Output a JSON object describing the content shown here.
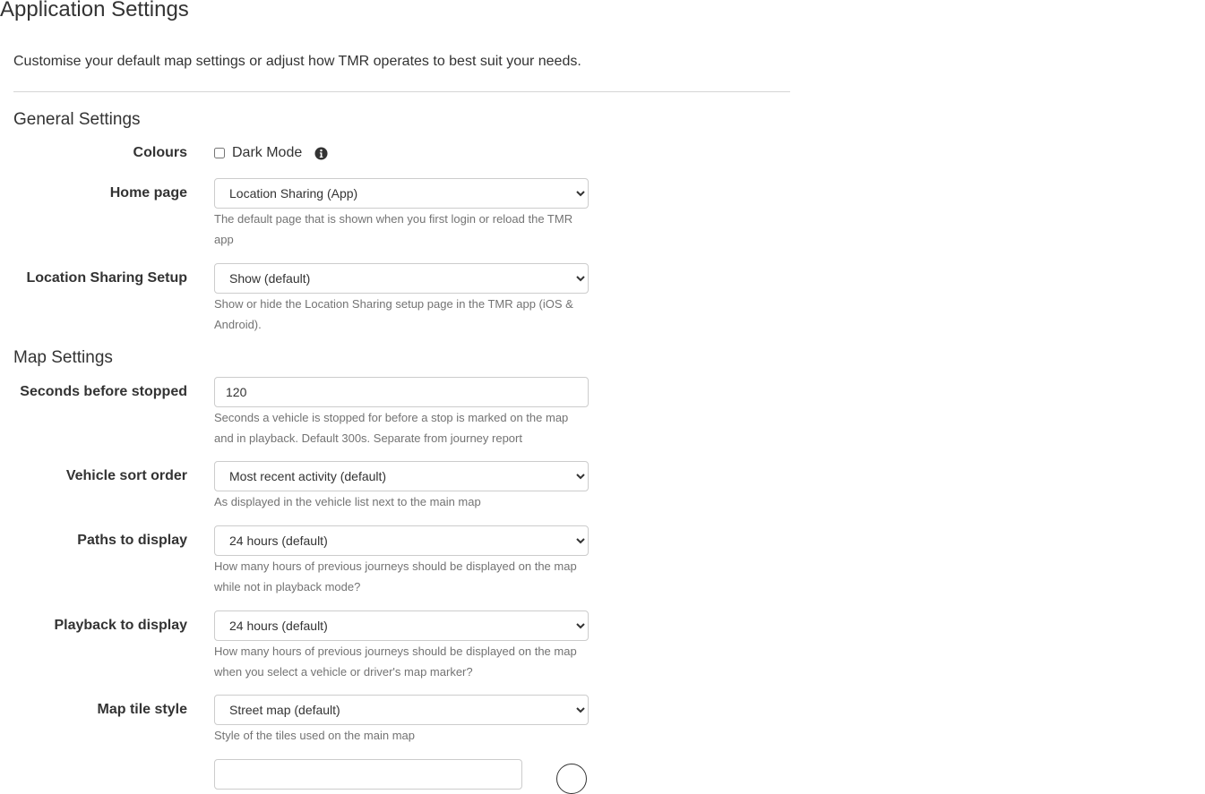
{
  "page": {
    "title": "Application Settings",
    "intro": "Customise your default map settings or adjust how TMR operates to best suit your needs."
  },
  "general": {
    "title": "General Settings",
    "colours": {
      "label": "Colours",
      "checkbox_label": "Dark Mode",
      "checked": false,
      "info_icon": "info-circle-icon"
    },
    "home_page": {
      "label": "Home page",
      "value": "Location Sharing (App)",
      "help": "The default page that is shown when you first login or reload the TMR app"
    },
    "location_sharing": {
      "label": "Location Sharing Setup",
      "value": "Show (default)",
      "help": "Show or hide the Location Sharing setup page in the TMR app (iOS & Android)."
    }
  },
  "map": {
    "title": "Map Settings",
    "seconds_stopped": {
      "label": "Seconds before stopped",
      "value": "120",
      "help": "Seconds a vehicle is stopped for before a stop is marked on the map and in playback. Default 300s. Separate from journey report"
    },
    "sort_order": {
      "label": "Vehicle sort order",
      "value": "Most recent activity (default)",
      "help": "As displayed in the vehicle list next to the main map"
    },
    "paths": {
      "label": "Paths to display",
      "value": "24 hours (default)",
      "help": "How many hours of previous journeys should be displayed on the map while not in playback mode?"
    },
    "playback": {
      "label": "Playback to display",
      "value": "24 hours (default)",
      "help": "How many hours of previous journeys should be displayed on the map when you select a vehicle or driver's map marker?"
    },
    "tile_style": {
      "label": "Map tile style",
      "value": "Street map (default)",
      "help": "Style of the tiles used on the main map"
    }
  },
  "colors": {
    "text": "#333333",
    "help_text": "#737373",
    "border": "#cccccc",
    "divider": "#d5d5d5"
  }
}
